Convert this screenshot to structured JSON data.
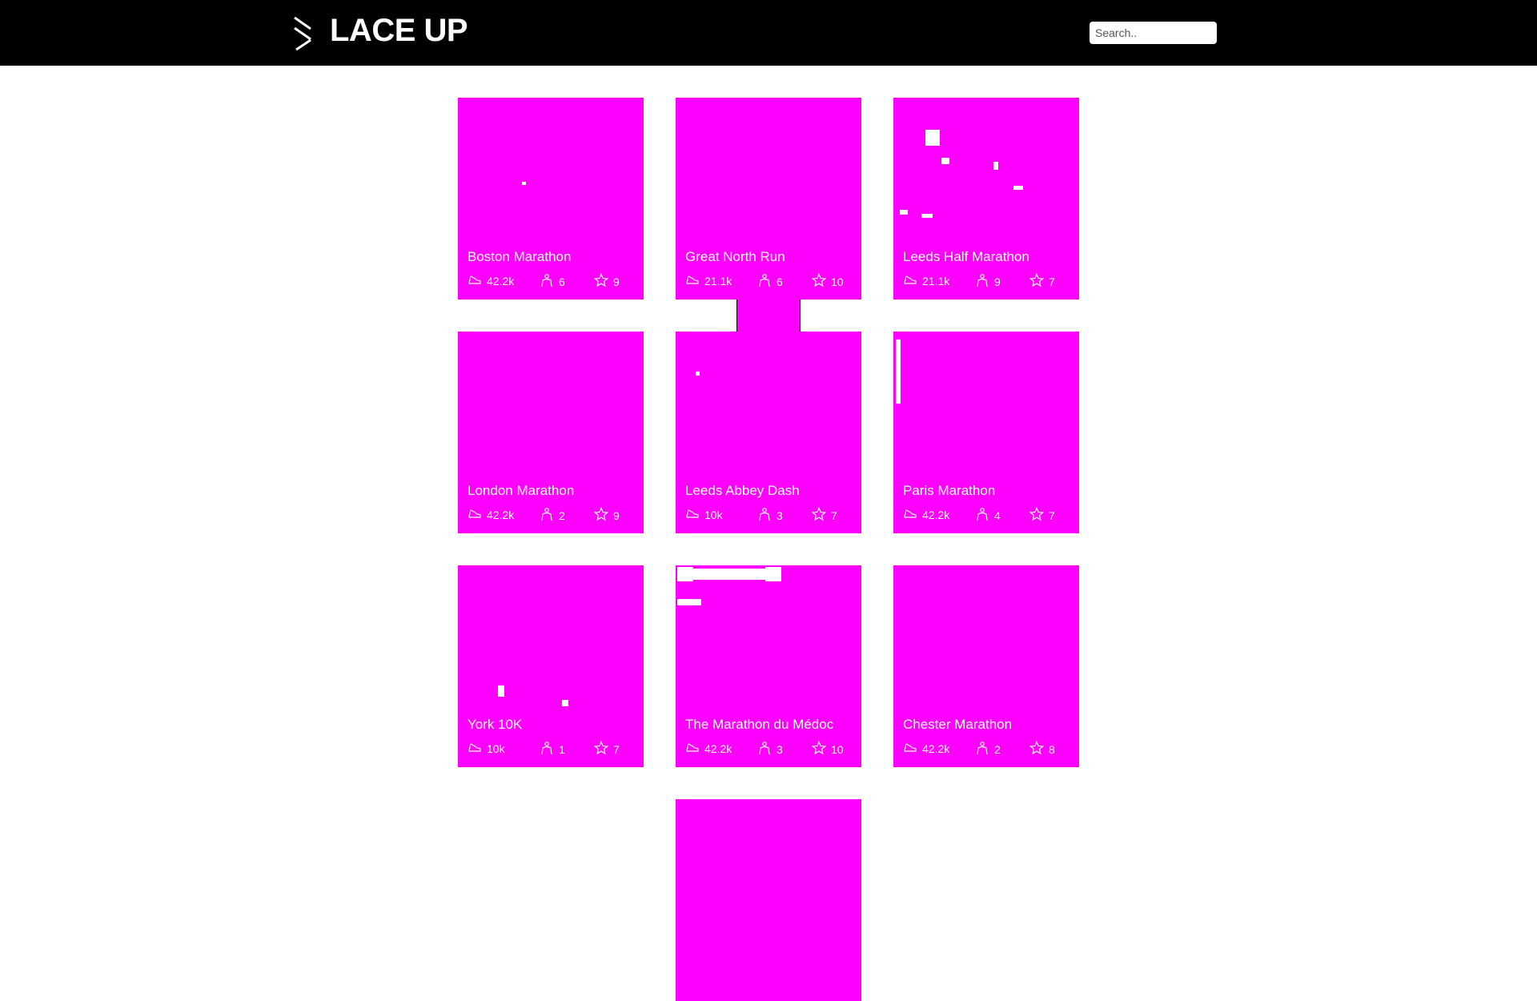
{
  "brand": {
    "name": "LACE UP"
  },
  "search": {
    "placeholder": "Search.."
  },
  "colors": {
    "header": "#000000",
    "card": "#ff00ff",
    "text": "#ffffff"
  },
  "events": [
    {
      "name": "Boston Marathon",
      "distance": "42.2k",
      "runners": "6",
      "rating": "9"
    },
    {
      "name": "Great North Run",
      "distance": "21.1k",
      "runners": "6",
      "rating": "10"
    },
    {
      "name": "Leeds Half Marathon",
      "distance": "21.1k",
      "runners": "9",
      "rating": "7"
    },
    {
      "name": "London Marathon",
      "distance": "42.2k",
      "runners": "2",
      "rating": "9"
    },
    {
      "name": "Leeds Abbey Dash",
      "distance": "10k",
      "runners": "3",
      "rating": "7"
    },
    {
      "name": "Paris Marathon",
      "distance": "42.2k",
      "runners": "4",
      "rating": "7"
    },
    {
      "name": "York 10K",
      "distance": "10k",
      "runners": "1",
      "rating": "7"
    },
    {
      "name": "The Marathon du Médoc",
      "distance": "42.2k",
      "runners": "3",
      "rating": "10"
    },
    {
      "name": "Chester Marathon",
      "distance": "42.2k",
      "runners": "2",
      "rating": "8"
    },
    {
      "name": "",
      "distance": "",
      "runners": "",
      "rating": ""
    }
  ]
}
